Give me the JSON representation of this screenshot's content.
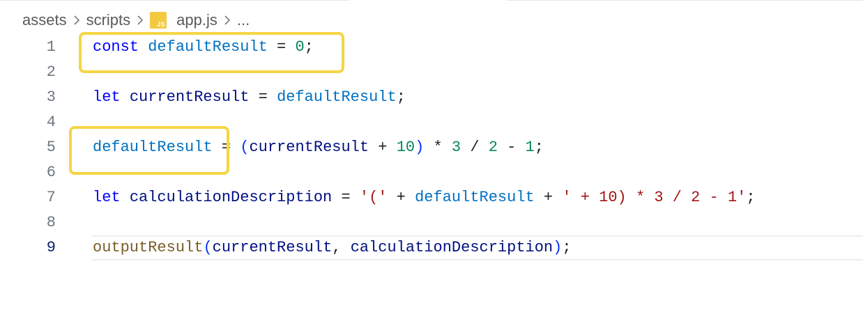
{
  "breadcrumb": {
    "items": [
      "assets",
      "scripts",
      "app.js",
      "..."
    ],
    "file_icon_label": "JS"
  },
  "editor": {
    "active_line": 9,
    "lines": [
      {
        "n": "1",
        "tokens": [
          {
            "t": "const",
            "c": "kw"
          },
          {
            "t": " ",
            "c": "op"
          },
          {
            "t": "defaultResult",
            "c": "cst"
          },
          {
            "t": " = ",
            "c": "op"
          },
          {
            "t": "0",
            "c": "num"
          },
          {
            "t": ";",
            "c": "op"
          }
        ]
      },
      {
        "n": "2",
        "tokens": []
      },
      {
        "n": "3",
        "tokens": [
          {
            "t": "let",
            "c": "kw"
          },
          {
            "t": " ",
            "c": "op"
          },
          {
            "t": "currentResult",
            "c": "var"
          },
          {
            "t": " = ",
            "c": "op"
          },
          {
            "t": "defaultResult",
            "c": "cst"
          },
          {
            "t": ";",
            "c": "op"
          }
        ]
      },
      {
        "n": "4",
        "tokens": []
      },
      {
        "n": "5",
        "tokens": [
          {
            "t": "defaultResult",
            "c": "cst"
          },
          {
            "t": " = ",
            "c": "op"
          },
          {
            "t": "(",
            "c": "pn"
          },
          {
            "t": "currentResult",
            "c": "var"
          },
          {
            "t": " + ",
            "c": "op"
          },
          {
            "t": "10",
            "c": "num"
          },
          {
            "t": ")",
            "c": "pn"
          },
          {
            "t": " * ",
            "c": "op"
          },
          {
            "t": "3",
            "c": "num"
          },
          {
            "t": " / ",
            "c": "op"
          },
          {
            "t": "2",
            "c": "num"
          },
          {
            "t": " - ",
            "c": "op"
          },
          {
            "t": "1",
            "c": "num"
          },
          {
            "t": ";",
            "c": "op"
          }
        ]
      },
      {
        "n": "6",
        "tokens": []
      },
      {
        "n": "7",
        "tokens": [
          {
            "t": "let",
            "c": "kw"
          },
          {
            "t": " ",
            "c": "op"
          },
          {
            "t": "calculationDescription",
            "c": "var"
          },
          {
            "t": " = ",
            "c": "op"
          },
          {
            "t": "'('",
            "c": "str"
          },
          {
            "t": " + ",
            "c": "op"
          },
          {
            "t": "defaultResult",
            "c": "cst"
          },
          {
            "t": " + ",
            "c": "op"
          },
          {
            "t": "' + 10) * 3 / 2 - 1'",
            "c": "str"
          },
          {
            "t": ";",
            "c": "op"
          }
        ]
      },
      {
        "n": "8",
        "tokens": []
      },
      {
        "n": "9",
        "tokens": [
          {
            "t": "outputResult",
            "c": "fn"
          },
          {
            "t": "(",
            "c": "pn"
          },
          {
            "t": "currentResult",
            "c": "var"
          },
          {
            "t": ", ",
            "c": "op"
          },
          {
            "t": "calculationDescription",
            "c": "var"
          },
          {
            "t": ")",
            "c": "pn"
          },
          {
            "t": ";",
            "c": "op"
          }
        ]
      }
    ]
  },
  "colors": {
    "highlight_box": "#f5d544",
    "keyword": "#0000ff",
    "constant": "#0070c1",
    "variable": "#001080",
    "number": "#098658",
    "string": "#a31515",
    "function": "#795e26"
  }
}
